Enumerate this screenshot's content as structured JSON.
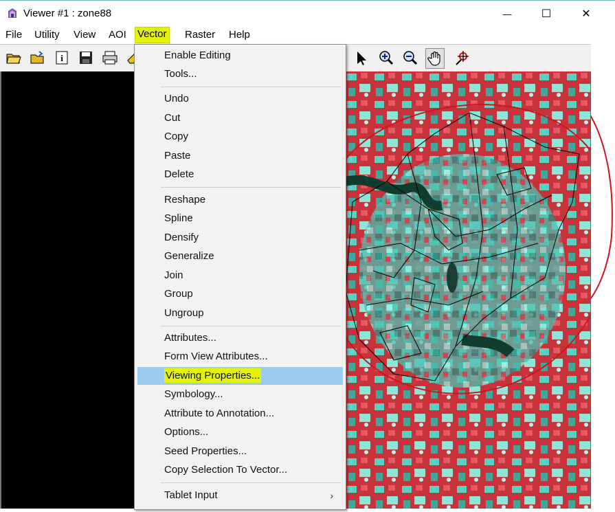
{
  "window": {
    "title": "Viewer #1 : zone88",
    "minimize_glyph": "—",
    "maximize_glyph": "☐",
    "close_glyph": "✕"
  },
  "menubar": {
    "items": [
      {
        "label": "File"
      },
      {
        "label": "Utility"
      },
      {
        "label": "View"
      },
      {
        "label": "AOI"
      },
      {
        "label": "Vector",
        "active": true
      },
      {
        "label": "Raster"
      },
      {
        "label": "Help"
      }
    ]
  },
  "toolbar": {
    "icons": [
      "open-folder-icon",
      "open-layer-icon",
      "info-icon",
      "save-icon",
      "print-icon",
      "eraser-icon",
      "pointer-icon",
      "zoom-in-icon",
      "zoom-out-icon",
      "pan-hand-icon",
      "inquire-cursor-icon"
    ]
  },
  "vector_menu": {
    "group1": [
      "Enable Editing",
      "Tools..."
    ],
    "group2": [
      "Undo",
      "Cut",
      "Copy",
      "Paste",
      "Delete"
    ],
    "group3": [
      "Reshape",
      "Spline",
      "Densify",
      "Generalize",
      "Join",
      "Group",
      "Ungroup"
    ],
    "group4": [
      "Attributes...",
      "Form View Attributes...",
      "Viewing Properties...",
      "Symbology...",
      "Attribute to Annotation...",
      "Options...",
      "Seed Properties...",
      "Copy Selection To Vector..."
    ],
    "group5": [
      "Tablet Input"
    ],
    "highlighted": "Viewing Properties...",
    "submenu_arrow": "›"
  },
  "colors": {
    "highlight_yellow": "#e2f20b",
    "hover_blue": "#9ccbf0",
    "annotation_red": "#d0141c",
    "imagery_red": "#c8323a",
    "imagery_cyan": "#5fd3c4"
  }
}
